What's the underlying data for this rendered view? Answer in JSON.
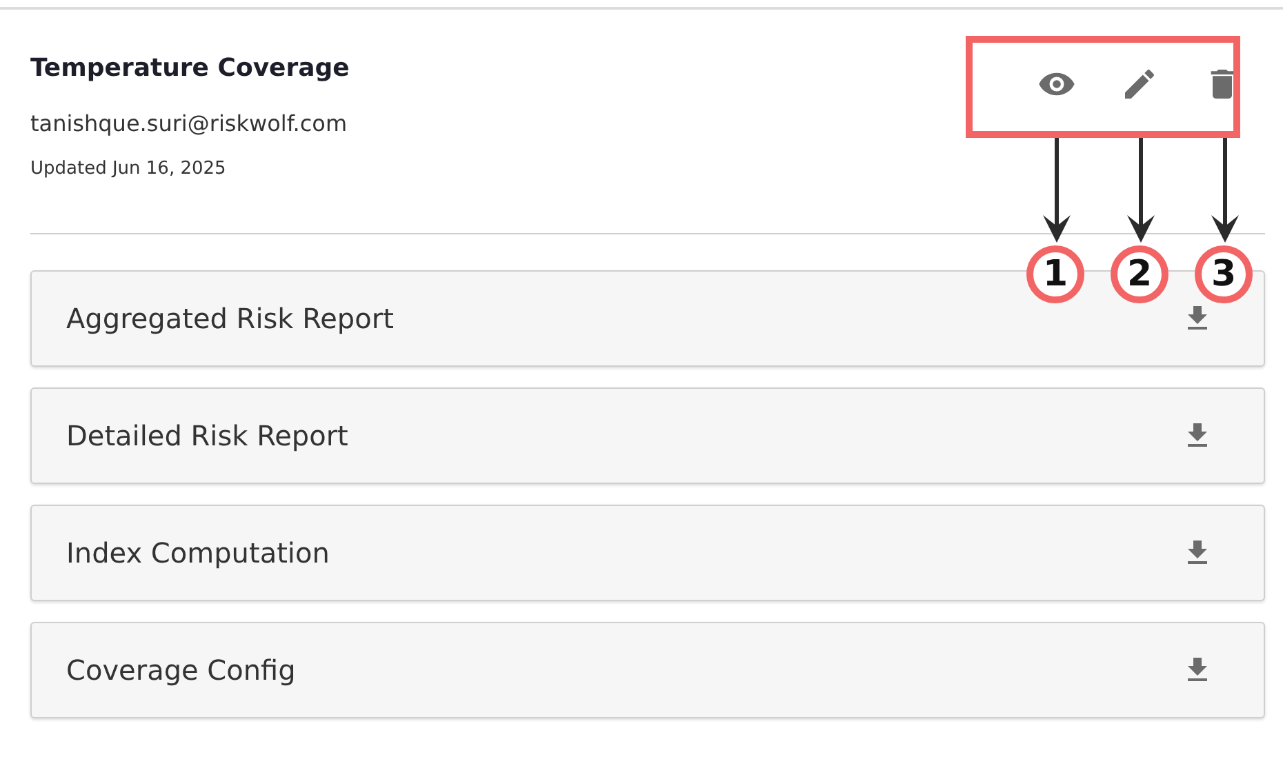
{
  "header": {
    "title": "Temperature Coverage",
    "email": "tanishque.suri@riskwolf.com",
    "updated": "Updated Jun 16, 2025"
  },
  "actions": [
    {
      "kind": "view"
    },
    {
      "kind": "edit"
    },
    {
      "kind": "delete"
    }
  ],
  "reports": [
    {
      "label": "Aggregated Risk Report"
    },
    {
      "label": "Detailed Risk Report"
    },
    {
      "label": "Index Computation"
    },
    {
      "label": "Coverage Config"
    }
  ],
  "callouts": [
    "1",
    "2",
    "3"
  ]
}
